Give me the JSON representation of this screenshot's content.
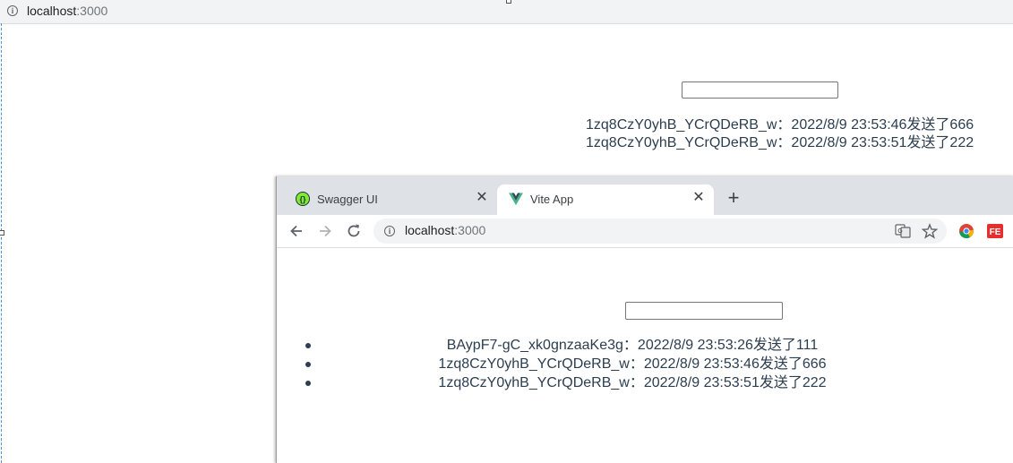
{
  "background_window": {
    "url_host": "localhost",
    "url_port": ":3000",
    "messages": [
      "1zq8CzY0yhB_YCrQDeRB_w：2022/8/9 23:53:46发送了666",
      "1zq8CzY0yhB_YCrQDeRB_w：2022/8/9 23:53:51发送了222"
    ]
  },
  "foreground_window": {
    "tabs": [
      {
        "title": "Swagger UI",
        "favicon": "swagger-icon",
        "active": false
      },
      {
        "title": "Vite App",
        "favicon": "vue-icon",
        "active": true
      }
    ],
    "close_glyph": "✕",
    "new_tab_glyph": "+",
    "address": {
      "host": "localhost",
      "port": ":3000"
    },
    "messages": [
      "BAypF7-gC_xk0gnzaaKe3g：2022/8/9 23:53:26发送了111",
      "1zq8CzY0yhB_YCrQDeRB_w：2022/8/9 23:53:46发送了666",
      "1zq8CzY0yhB_YCrQDeRB_w：2022/8/9 23:53:51发送了222"
    ]
  },
  "colors": {
    "accent_text": "#2c3e50",
    "tabstrip": "#dee1e6",
    "omnibox": "#f1f3f4"
  }
}
